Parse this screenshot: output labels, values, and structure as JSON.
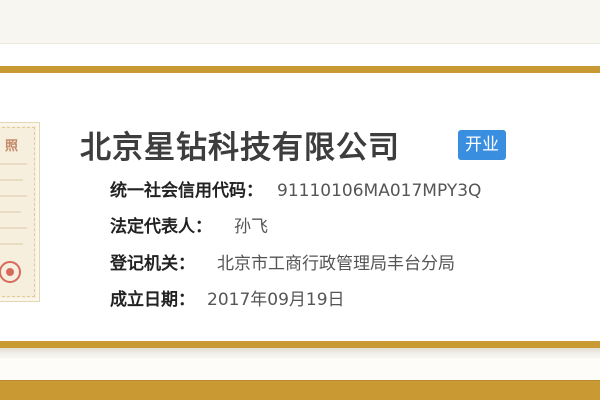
{
  "company": {
    "name": "北京星钻科技有限公司",
    "status": "开业"
  },
  "license_thumbnail": {
    "title_glyph": "照"
  },
  "info": [
    {
      "label": "统一社会信用代码：",
      "value": "91110106MA017MPY3Q"
    },
    {
      "label": "法定代表人：",
      "value": "孙飞"
    },
    {
      "label": "登记机关：",
      "value": "北京市工商行政管理局丰台分局"
    },
    {
      "label": "成立日期：",
      "value": "2017年09月19日"
    }
  ],
  "colors": {
    "gold": "#c99a34",
    "badge_blue": "#3a8ee0",
    "title_text": "#3d3d3d"
  }
}
